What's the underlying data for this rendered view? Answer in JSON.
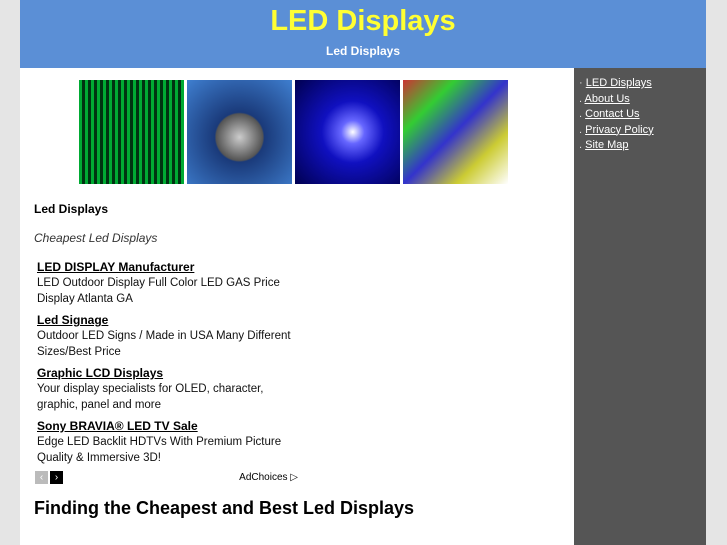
{
  "header": {
    "title": "LED Displays",
    "subtitle": "Led Displays"
  },
  "sidebar": {
    "items": [
      {
        "label": "LED Displays"
      },
      {
        "label": "About Us"
      },
      {
        "label": "Contact Us"
      },
      {
        "label": "Privacy Policy"
      },
      {
        "label": "Site Map"
      }
    ]
  },
  "main": {
    "heading": "Led Displays",
    "tagline": "Cheapest Led Displays",
    "ads": [
      {
        "title": "LED DISPLAY Manufacturer",
        "text": "LED Outdoor Display Full Color LED GAS Price Display Atlanta GA"
      },
      {
        "title": "Led Signage",
        "text": "Outdoor LED Signs / Made in USA Many Different Sizes/Best Price"
      },
      {
        "title": "Graphic LCD Displays",
        "text": "Your display specialists for OLED, character, graphic, panel and more"
      },
      {
        "title": "Sony BRAVIA® LED TV Sale",
        "text": "Edge LED Backlit HDTVs With Premium Picture Quality & Immersive 3D!"
      }
    ],
    "adchoices": "AdChoices ▷",
    "prev": "‹",
    "next": "›",
    "article_title": "Finding the Cheapest and Best Led Displays"
  }
}
